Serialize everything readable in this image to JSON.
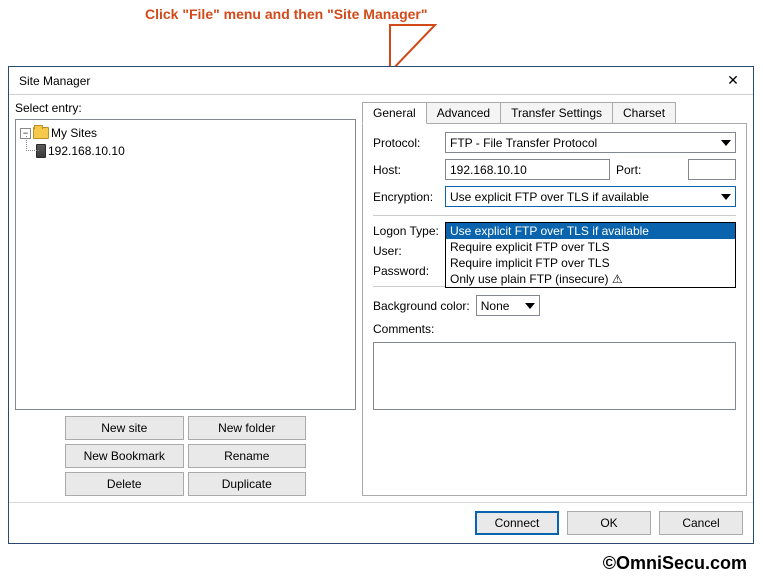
{
  "annotation": {
    "text": "Click \"File\" menu and then \"Site Manager\"",
    "watermark": "OmniSecu.com",
    "copyright": "©OmniSecu.com"
  },
  "dialog": {
    "title": "Site Manager",
    "select_entry_label": "Select entry:",
    "tree": {
      "root": {
        "label": "My Sites",
        "expanded": true
      },
      "items": [
        {
          "label": "192.168.10.10"
        }
      ]
    },
    "buttons": {
      "new_site": "New site",
      "new_folder": "New folder",
      "new_bookmark": "New Bookmark",
      "rename": "Rename",
      "delete": "Delete",
      "duplicate": "Duplicate"
    },
    "tabs": {
      "general": "General",
      "advanced": "Advanced",
      "transfer": "Transfer Settings",
      "charset": "Charset"
    },
    "general": {
      "protocol_label": "Protocol:",
      "protocol_value": "FTP - File Transfer Protocol",
      "host_label": "Host:",
      "host_value": "192.168.10.10",
      "port_label": "Port:",
      "port_value": "",
      "encryption_label": "Encryption:",
      "encryption_value": "Use explicit FTP over TLS if available",
      "encryption_options": [
        "Use explicit FTP over TLS if available",
        "Require explicit FTP over TLS",
        "Require implicit FTP over TLS",
        "Only use plain FTP (insecure) ⚠"
      ],
      "logon_type_label": "Logon Type:",
      "logon_type_value": "",
      "user_label": "User:",
      "user_value": "",
      "password_label": "Password:",
      "password_value": "",
      "bgcolor_label": "Background color:",
      "bgcolor_value": "None",
      "comments_label": "Comments:",
      "comments_value": ""
    },
    "bottom": {
      "connect": "Connect",
      "ok": "OK",
      "cancel": "Cancel"
    }
  }
}
